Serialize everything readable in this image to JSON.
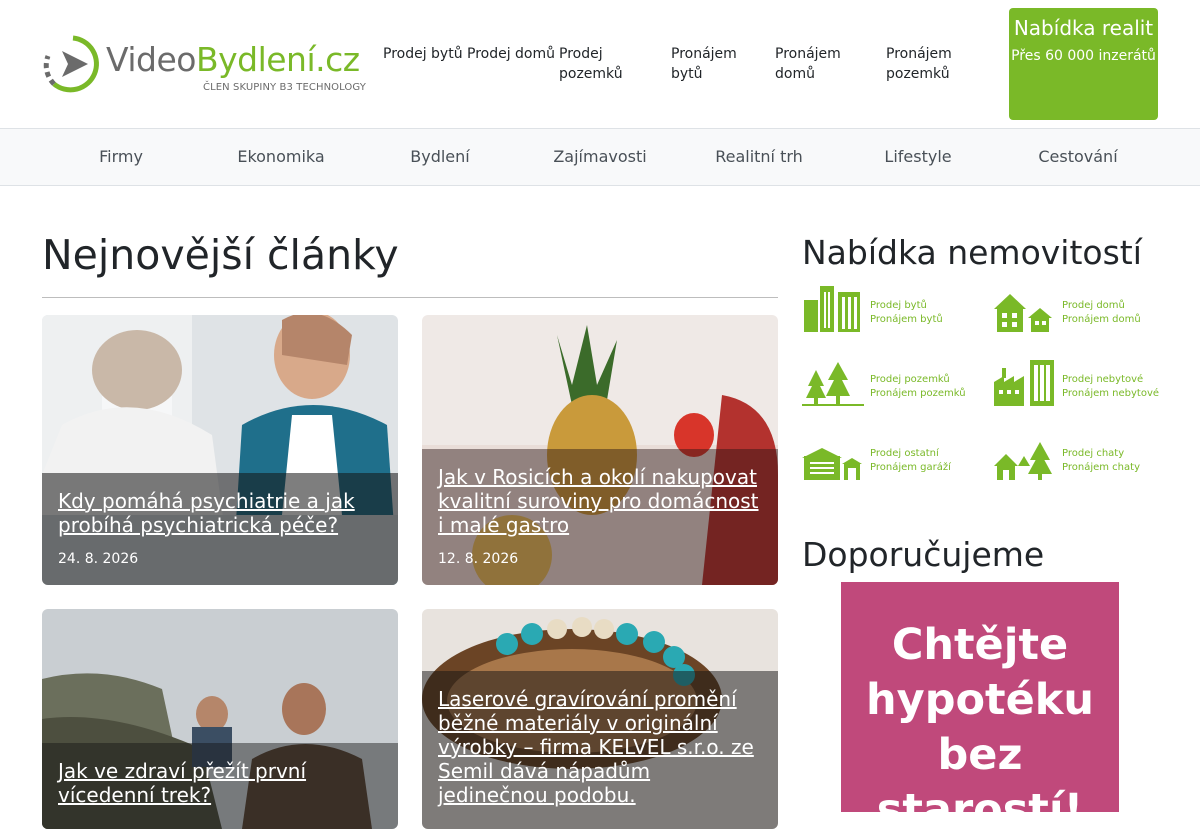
{
  "logo": {
    "part1": "Video",
    "part2": "Bydlení.cz",
    "sub": "ČLEN SKUPINY B3 TECHNOLOGY"
  },
  "topnav": [
    "Prodej bytů",
    "Prodej domů",
    "Prodej pozemků",
    "Pronájem bytů",
    "Pronájem domů",
    "Pronájem pozemků"
  ],
  "cta": {
    "title": "Nabídka realit",
    "subtitle": "Přes 60 000 inzerátů"
  },
  "categories": [
    "Firmy",
    "Ekonomika",
    "Bydlení",
    "Zajímavosti",
    "Realitní trh",
    "Lifestyle",
    "Cestování"
  ],
  "main": {
    "heading": "Nejnovější články",
    "articles": [
      {
        "title": "Kdy pomáhá psychiatrie a jak probíhá psychiatrická péče?",
        "date": "24. 8. 2026"
      },
      {
        "title": "Jak v Rosicích a okolí nakupovat kvalitní suroviny pro domácnost i malé gastro",
        "date": "12. 8. 2026"
      },
      {
        "title": "Jak ve zdraví přežít první vícedenní trek?",
        "date": ""
      },
      {
        "title": "Laserové gravírování promění běžné materiály v originální výrobky – firma KELVEL s.r.o. ze Semil dává nápadům jedinečnou podobu.",
        "date": ""
      }
    ]
  },
  "sidebar": {
    "heading": "Nabídka nemovitostí",
    "offers": [
      {
        "l1": "Prodej bytů",
        "l2": "Pronájem bytů",
        "icon": "apartment-buildings-icon"
      },
      {
        "l1": "Prodej domů",
        "l2": "Pronájem domů",
        "icon": "houses-icon"
      },
      {
        "l1": "Prodej pozemků",
        "l2": "Pronájem pozemků",
        "icon": "trees-land-icon"
      },
      {
        "l1": "Prodej nebytové",
        "l2": "Pronájem nebytové",
        "icon": "factory-icon"
      },
      {
        "l1": "Prodej ostatní",
        "l2": "Pronájem garáží",
        "icon": "garage-icon"
      },
      {
        "l1": "Prodej chaty",
        "l2": "Pronájem chaty",
        "icon": "cottage-icon"
      }
    ],
    "rec_heading": "Doporučujeme",
    "banner_text": "Chtějte hypotéku bez starostí!"
  },
  "colors": {
    "brand_green": "#7ab928",
    "logo_grey": "#6b6b6b",
    "banner_pink": "#c0497b"
  }
}
